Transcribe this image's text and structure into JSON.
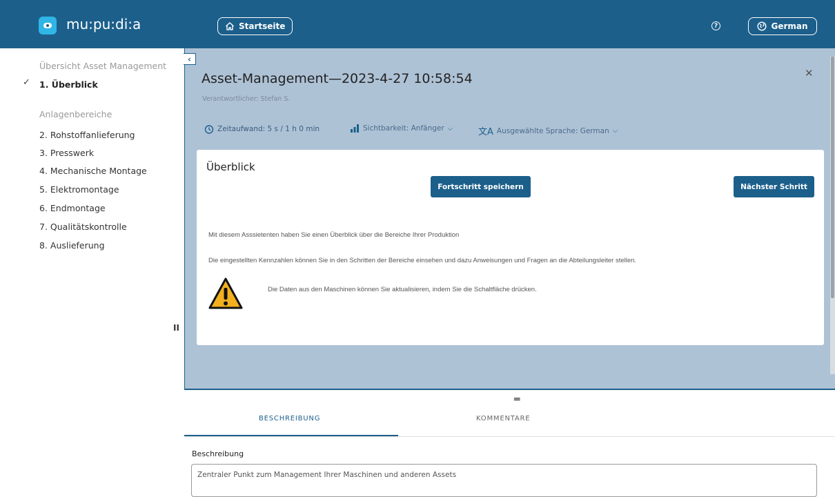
{
  "header": {
    "brand": "mu:pu:di:a",
    "home_label": "Startseite",
    "help_icon": "help-icon",
    "language_label": "German"
  },
  "sidebar": {
    "overview_link": "Übersicht Asset Management",
    "active_step": "1. Überblick",
    "section_label": "Anlagenbereiche",
    "items": [
      "2. Rohstoffanlieferung",
      "3. Presswerk",
      "4. Mechanische Montage",
      "5. Elektromontage",
      "6. Endmontage",
      "7. Qualitätskontrolle",
      "8. Auslieferung"
    ]
  },
  "main": {
    "title": "Asset-Management—2023-4-27 10:58:54",
    "subtitle": "Verantwortlicher: Stefan S.",
    "time_effort": "Zeitaufwand: 5 s / 1 h 0 min",
    "visibility": "Sichtbarkeit: Anfänger",
    "language": "Ausgewählte Sprache: German"
  },
  "card": {
    "heading": "Überblick",
    "save_button": "Fortschritt speichern",
    "next_button": "Nächster Schritt",
    "text1": "Mit diesem Asssietenten haben Sie einen Überblick über die Bereiche Ihrer Produktion",
    "text2": "Die eingestellten Kennzahlen können Sie in den Schritten der Bereiche einsehen und dazu Anweisungen und Fragen an die Abteilungsleiter stellen.",
    "text3": "Die Daten aus den Maschinen können Sie aktualisieren, indem Sie die Schaltfläche drücken."
  },
  "tabs": {
    "description": "BESCHREIBUNG",
    "comments": "KOMMENTARE"
  },
  "description": {
    "label": "Beschreibung",
    "value": "Zentraler Punkt zum Management Ihrer Maschinen und anderen Assets"
  },
  "colors": {
    "primary": "#1c5f8b",
    "panel": "#aec2d6",
    "warning": "#f2b01e"
  }
}
